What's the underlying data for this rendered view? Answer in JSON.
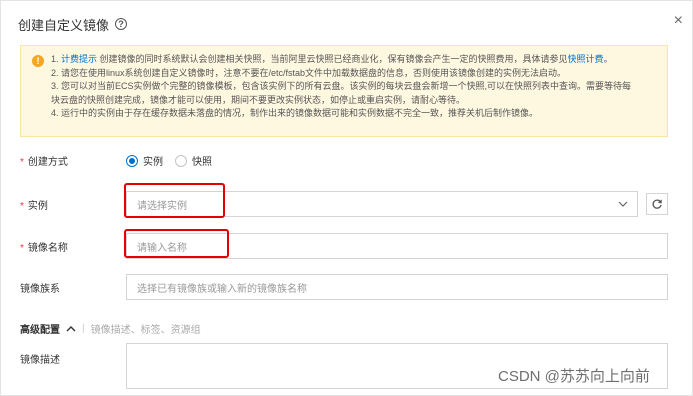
{
  "dialog": {
    "title": "创建自定义镜像",
    "close_symbol": "×"
  },
  "notice": {
    "line1_prefix": "1. ",
    "line1_highlight": "计费提示",
    "line1_text": " 创建镜像的同时系统默认会创建相关快照，当前阿里云快照已经商业化，保有镜像会产生一定的快照费用，具体请参见",
    "line1_link": "快照计费",
    "line1_suffix": "。",
    "line2": "2. 请您在使用linux系统创建自定义镜像时，注意不要在/etc/fstab文件中加载数据盘的信息，否则使用该镜像创建的实例无法启动。",
    "line3": "3. 您可以对当前ECS实例做个完整的镜像模板，包含该实例下的所有云盘。该实例的每块云盘会新增一个快照,可以在快照列表中查询。需要等待每",
    "line4": "块云盘的快照创建完成，镜像才能可以使用，期间不要更改实例状态，如停止或重启实例，请耐心等待。",
    "line5": "4. 运行中的实例由于存在缓存数据未落盘的情况，制作出来的镜像数据可能和实例数据不完全一致，推荐关机后制作镜像。"
  },
  "form": {
    "create_method": {
      "required_mark": "*",
      "label": "创建方式",
      "options": [
        "实例",
        "快照"
      ],
      "selected": "实例"
    },
    "instance": {
      "required_mark": "*",
      "label": "实例",
      "placeholder": "请选择实例"
    },
    "image_name": {
      "required_mark": "*",
      "label": "镜像名称",
      "placeholder": "请输入名称"
    },
    "image_family": {
      "label": "镜像族系",
      "placeholder": "选择已有镜像族或输入新的镜像族名称"
    },
    "advanced": {
      "title": "高级配置",
      "separator": "|",
      "subtitle": "镜像描述、标签、资源组"
    },
    "description": {
      "label": "镜像描述"
    }
  },
  "watermark": "CSDN @苏苏向上向前",
  "colors": {
    "accent": "#0070cc",
    "required": "#e13b3b",
    "highlight_box": "#e60000",
    "notice_bg": "#fff8e1",
    "warning_icon": "#f5a623"
  },
  "icons": [
    "help-icon",
    "close-icon",
    "warning-icon",
    "chevron-down-icon",
    "refresh-icon",
    "chevron-up-icon"
  ]
}
